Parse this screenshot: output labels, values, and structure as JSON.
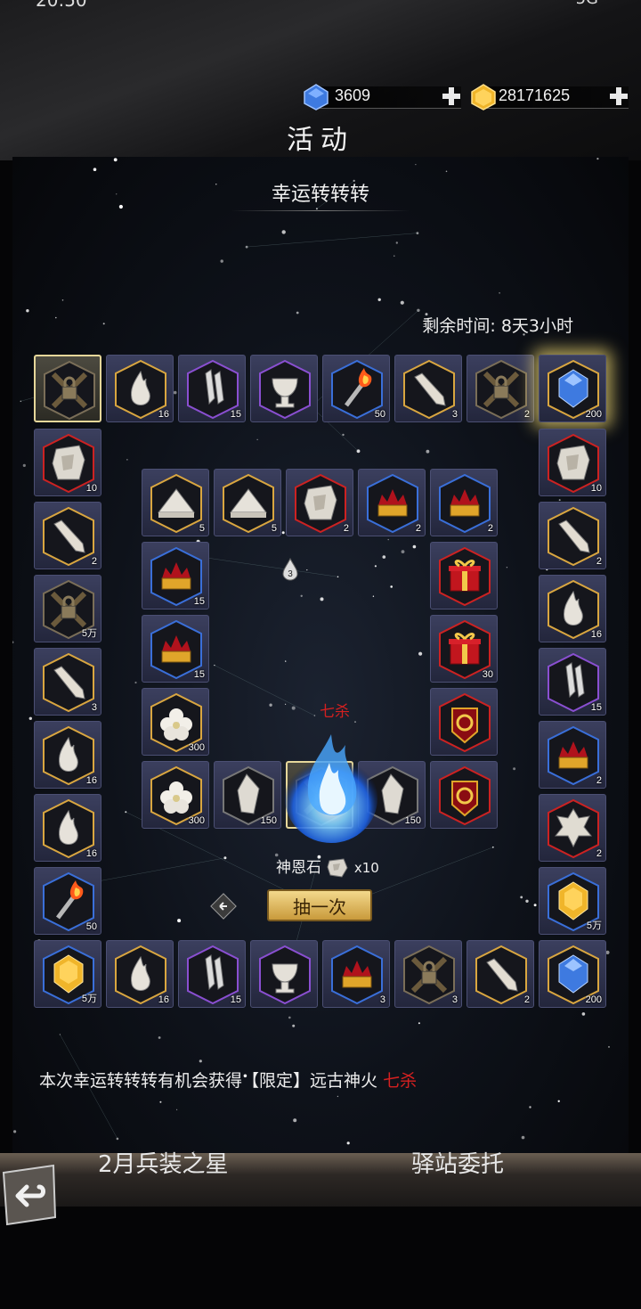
{
  "status_bar": {
    "time": "20:50",
    "right": "5G"
  },
  "currency": {
    "diamond": {
      "value": "3609",
      "icon": "blue-gem-icon",
      "color": "#3e7ae0"
    },
    "gold": {
      "value": "28171625",
      "icon": "gold-gem-icon",
      "color": "#f0b52a"
    }
  },
  "header": {
    "title": "活动"
  },
  "event": {
    "title": "幸运转转转",
    "remaining": "剩余时间: 8天3小时",
    "center_item_label": "七杀",
    "center_badge": "3",
    "cost_label": "神恩石",
    "cost_count": "x10",
    "draw_button": "抽一次",
    "footer_prefix": "本次幸运转转转有机会获得【限定】远古神火",
    "footer_highlight": "七杀"
  },
  "outer_ring": [
    {
      "icon": "locked-chest-icon",
      "count": ""
    },
    {
      "icon": "flame-icon",
      "count": "16"
    },
    {
      "icon": "crystal-icon",
      "count": "15"
    },
    {
      "icon": "chalice-icon",
      "count": ""
    },
    {
      "icon": "torch-icon",
      "count": "50"
    },
    {
      "icon": "bone-key-icon",
      "count": "3"
    },
    {
      "icon": "locked-chest-icon",
      "count": "2"
    },
    {
      "icon": "blue-gem-icon",
      "count": "200"
    },
    {
      "icon": "stone-icon",
      "count": "10"
    },
    {
      "icon": "bone-key-icon",
      "count": "2"
    },
    {
      "icon": "locked-chest-icon",
      "count": "5万"
    },
    {
      "icon": "bone-key-icon",
      "count": "3"
    },
    {
      "icon": "flame-icon",
      "count": "16"
    },
    {
      "icon": "flame-icon",
      "count": "16"
    },
    {
      "icon": "torch-icon",
      "count": "50"
    },
    {
      "icon": "gold-gem-icon",
      "count": "5万"
    },
    {
      "icon": "flame-icon",
      "count": "16"
    },
    {
      "icon": "crystal-icon",
      "count": "15"
    },
    {
      "icon": "chalice-icon",
      "count": ""
    },
    {
      "icon": "crown-icon",
      "count": "3"
    },
    {
      "icon": "locked-chest-icon",
      "count": "3"
    },
    {
      "icon": "bone-key-icon",
      "count": "2"
    },
    {
      "icon": "blue-gem-icon",
      "count": "200"
    },
    {
      "icon": "stone-icon",
      "count": "10"
    },
    {
      "icon": "bone-key-icon",
      "count": "2"
    },
    {
      "icon": "flame-icon",
      "count": "16"
    },
    {
      "icon": "crystal-icon",
      "count": "15"
    },
    {
      "icon": "crown-icon",
      "count": "2"
    },
    {
      "icon": "spiky-stone-icon",
      "count": "2"
    },
    {
      "icon": "gold-gem-icon",
      "count": "5万"
    }
  ],
  "inner_ring": [
    {
      "icon": "pyramid-icon",
      "count": "5"
    },
    {
      "icon": "pyramid-icon",
      "count": "5"
    },
    {
      "icon": "stone-icon",
      "count": "2"
    },
    {
      "icon": "crown-icon",
      "count": "2"
    },
    {
      "icon": "crown-icon",
      "count": "2"
    },
    {
      "icon": "crown-icon",
      "count": "15"
    },
    {
      "icon": "gift-icon",
      "count": ""
    },
    {
      "icon": "crown-icon",
      "count": "15"
    },
    {
      "icon": "gift-icon",
      "count": "30"
    },
    {
      "icon": "flower-icon",
      "count": "300"
    },
    {
      "icon": "emblem-icon",
      "count": ""
    },
    {
      "icon": "flower-icon",
      "count": "300"
    },
    {
      "icon": "shard-icon",
      "count": "150"
    },
    {
      "icon": "locked-chest-icon",
      "count": ""
    },
    {
      "icon": "shard-icon",
      "count": "150"
    },
    {
      "icon": "emblem-icon",
      "count": ""
    }
  ],
  "bottom": {
    "left_label": "2月兵装之星",
    "right_label": "驿站委托"
  }
}
